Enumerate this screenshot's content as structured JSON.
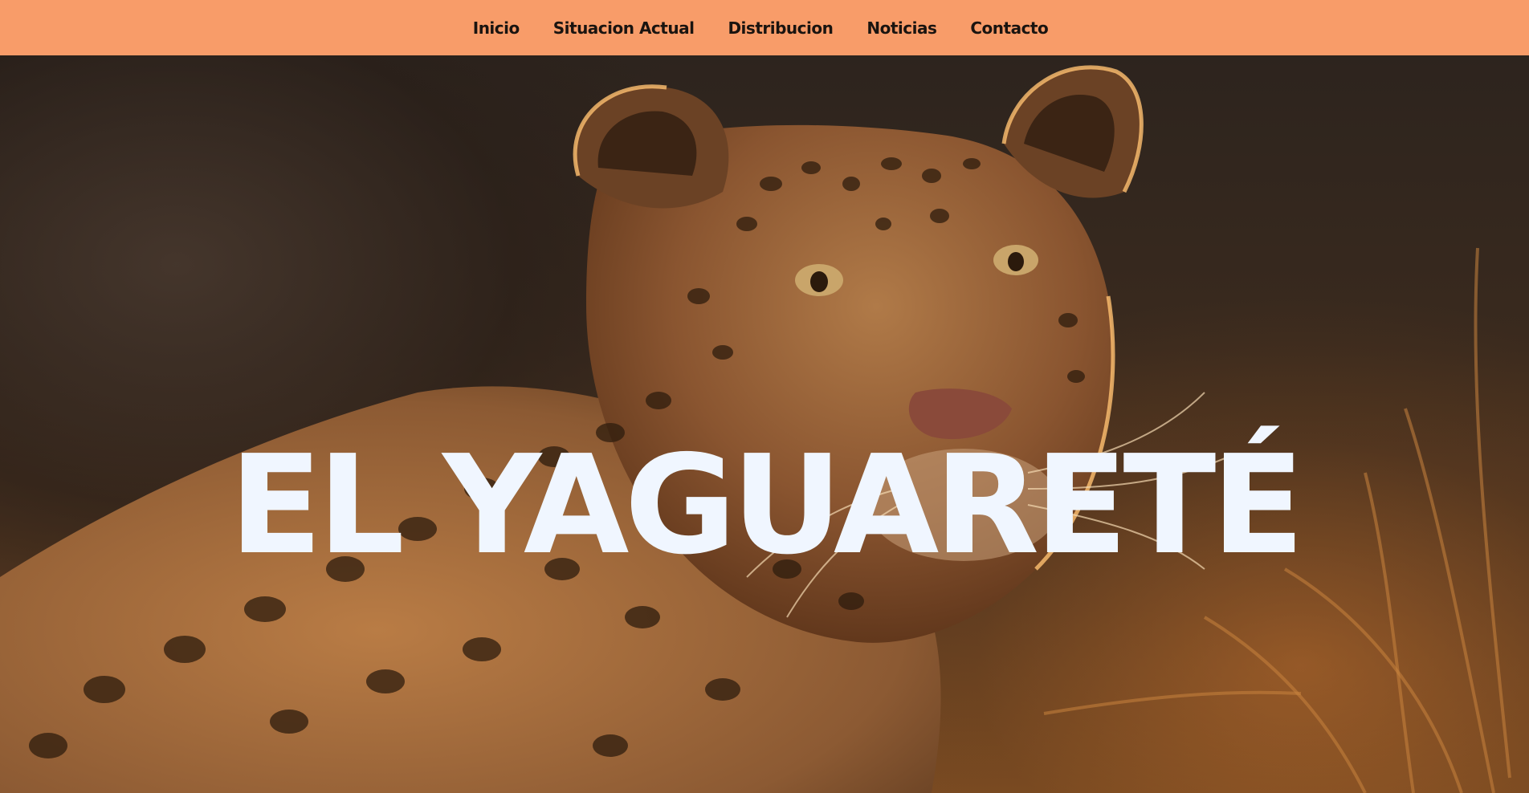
{
  "nav": {
    "items": [
      {
        "label": "Inicio"
      },
      {
        "label": "Situacion Actual"
      },
      {
        "label": "Distribucion"
      },
      {
        "label": "Noticias"
      },
      {
        "label": "Contacto"
      }
    ]
  },
  "hero": {
    "title": "EL YAGUARETÉ",
    "image_subject": "jaguar"
  },
  "colors": {
    "nav_background": "#f89c69",
    "nav_text": "#1a1410",
    "title_text": "#f0f6ff"
  }
}
